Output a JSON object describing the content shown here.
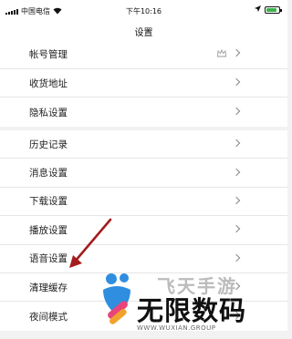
{
  "status_bar": {
    "carrier": "中国电信",
    "time": "下午10:16"
  },
  "nav": {
    "title": "设置"
  },
  "groups": [
    {
      "items": [
        {
          "label": "帐号管理",
          "icon": "crown-icon"
        },
        {
          "label": "收货地址"
        },
        {
          "label": "隐私设置"
        }
      ]
    },
    {
      "items": [
        {
          "label": "历史记录"
        },
        {
          "label": "消息设置"
        },
        {
          "label": "下载设置"
        },
        {
          "label": "播放设置"
        },
        {
          "label": "语音设置"
        },
        {
          "label": "清理缓存"
        },
        {
          "label": "夜间模式"
        }
      ]
    }
  ],
  "annotation": {
    "arrow_color": "#a31d1d"
  },
  "watermark": {
    "title": "无限数码",
    "ghost_text": "飞天手游",
    "url": "WWW.WUXIAN.GROUP",
    "colors": {
      "blue": "#2f8ee0",
      "pink": "#e8457a",
      "orange": "#f2a12c"
    }
  }
}
